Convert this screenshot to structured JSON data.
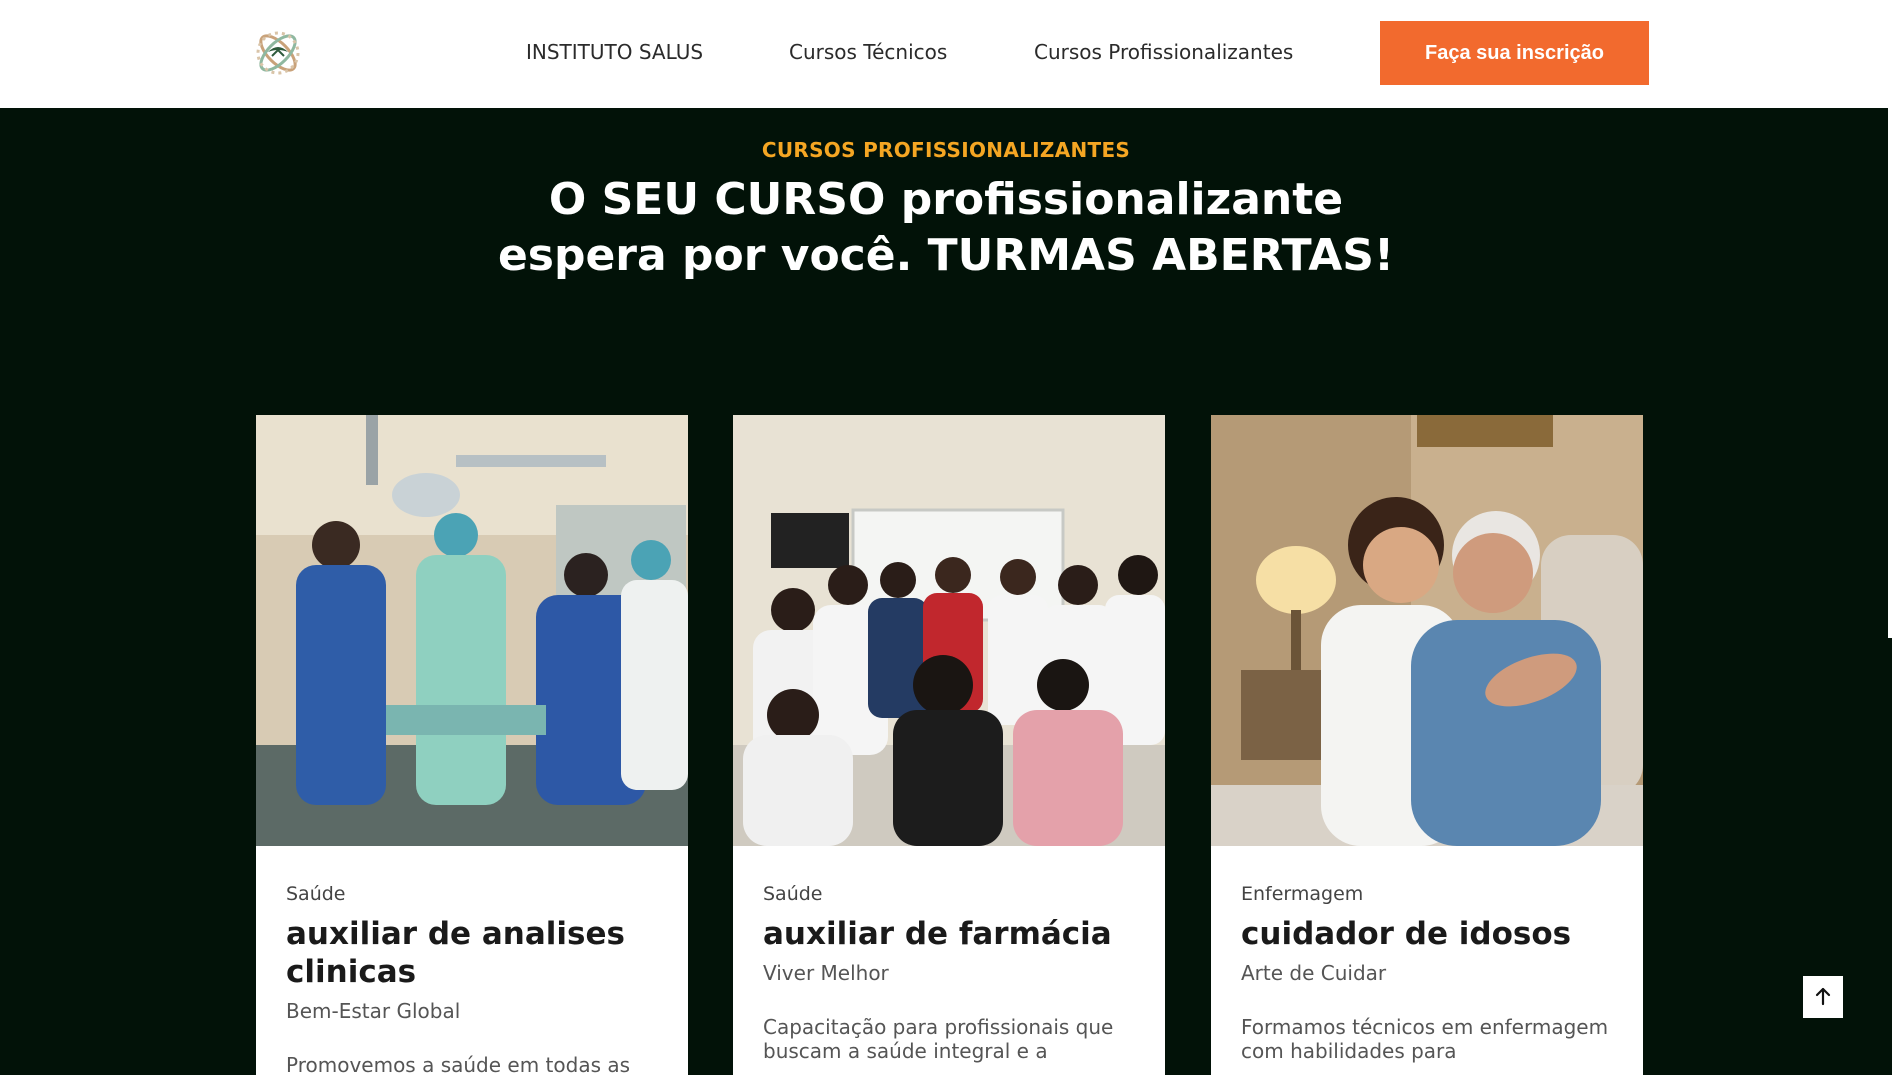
{
  "header": {
    "nav": [
      {
        "label": "INSTITUTO SALUS"
      },
      {
        "label": "Cursos Técnicos"
      },
      {
        "label": "Cursos Profissionalizantes"
      }
    ],
    "cta_label": "Faça sua inscrição"
  },
  "hero": {
    "eyebrow": "CURSOS PROFISSIONALIZANTES",
    "headline_line1": "O SEU CURSO profissionalizante",
    "headline_line2": "espera por você. TURMAS ABERTAS!"
  },
  "courses": [
    {
      "category": "Saúde",
      "title": "auxiliar de analises clinicas",
      "subtitle": "Bem-Estar Global",
      "description": "Promovemos a saúde em todas as",
      "image_icon": "lab-team-photo"
    },
    {
      "category": "Saúde",
      "title": "auxiliar de farmácia",
      "subtitle": "Viver Melhor",
      "description": "Capacitação para profissionais que buscam a saúde integral e a",
      "image_icon": "pharmacy-class-photo"
    },
    {
      "category": "Enfermagem",
      "title": "cuidador de idosos",
      "subtitle": "Arte de Cuidar",
      "description": "Formamos técnicos em enfermagem com habilidades para",
      "image_icon": "caregiver-elderly-photo"
    }
  ],
  "colors": {
    "accent": "#f26a2e",
    "eyebrow": "#f5a623",
    "background": "#021208"
  }
}
